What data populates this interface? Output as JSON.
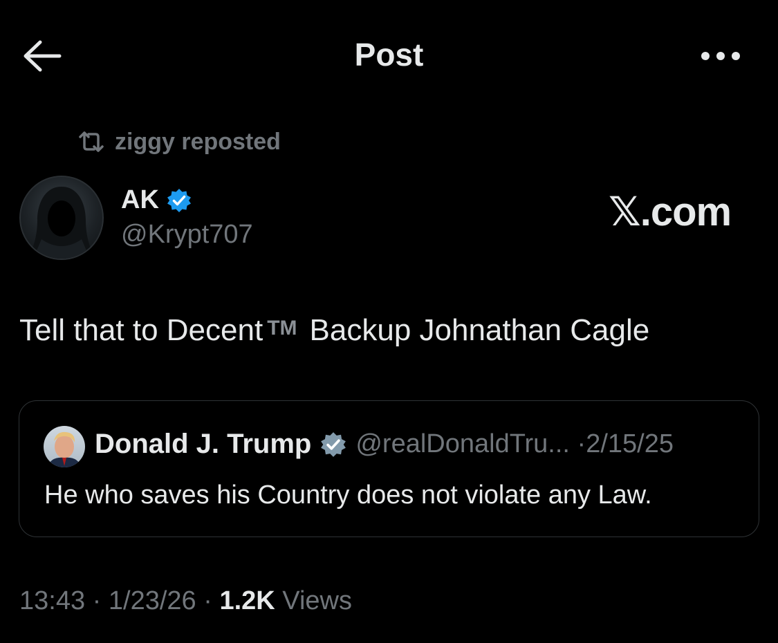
{
  "header": {
    "title": "Post"
  },
  "repost": {
    "text": "ziggy reposted"
  },
  "author": {
    "name": "AK",
    "handle": "@Krypt707"
  },
  "watermark": "𝕏.com",
  "tweet": {
    "text_before": "Tell that to Decent",
    "tm": "TM",
    "text_after": "Backup Johnathan Cagle"
  },
  "quote": {
    "name": "Donald J. Trump",
    "handle": "@realDonaldTru...",
    "separator": "·",
    "date": "2/15/25",
    "text": "He who saves his Country does not violate any Law."
  },
  "footer": {
    "time": "13:43",
    "sep1": "·",
    "date": "1/23/26",
    "sep2": "·",
    "views_count": "1.2K",
    "views_label": "Views"
  },
  "colors": {
    "background": "#000000",
    "text": "#e7e9ea",
    "muted": "#71767b",
    "verified": "#1d9bf0",
    "border": "#2f3336"
  }
}
